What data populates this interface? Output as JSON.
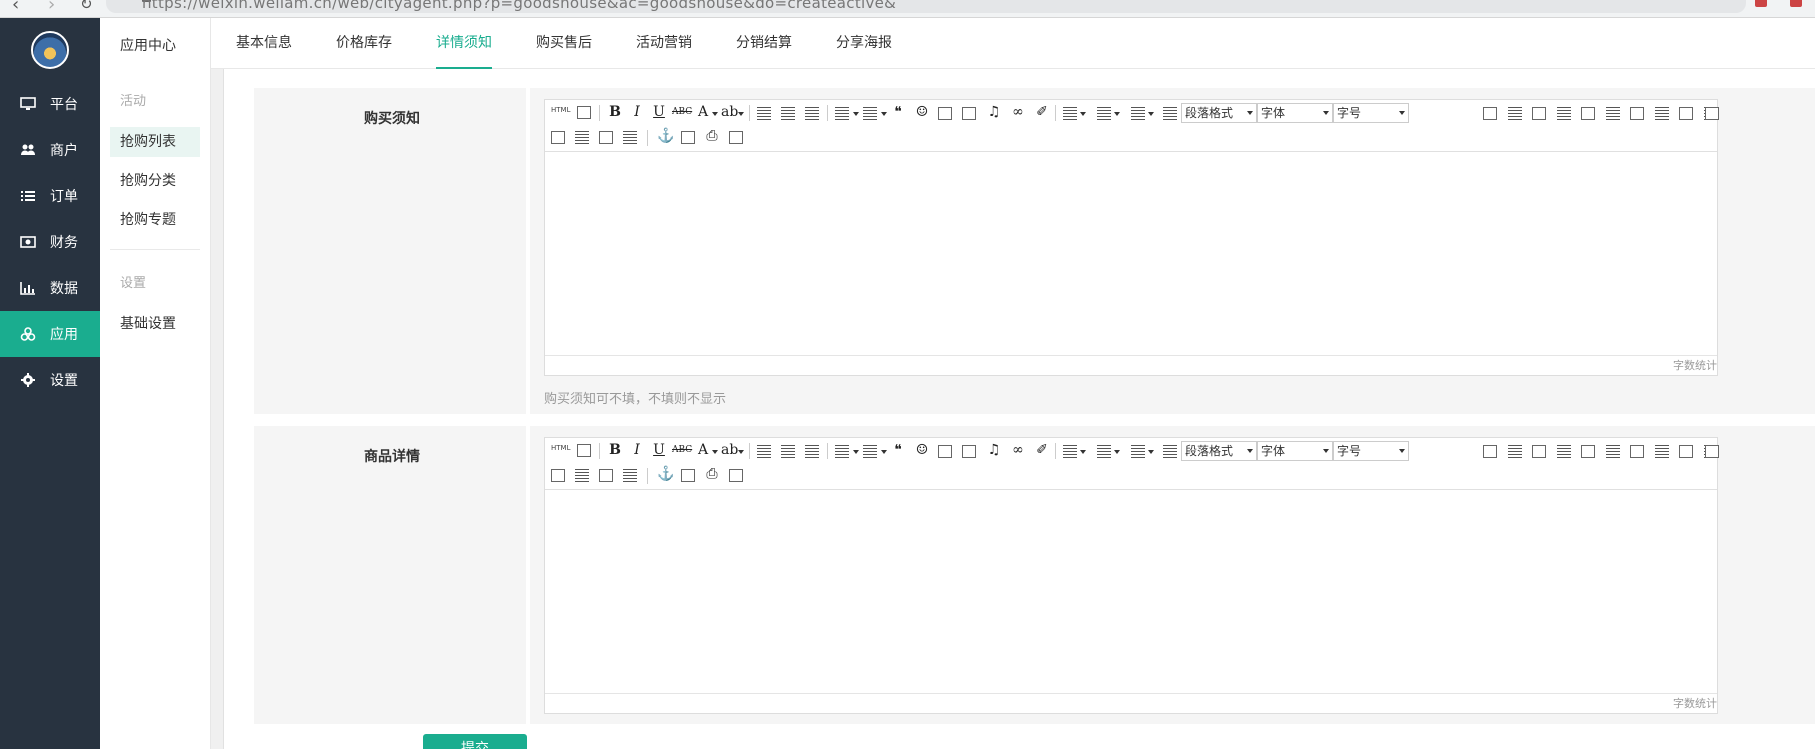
{
  "browser": {
    "url": "https://weixin.weliam.cn/web/cityagent.php?p=goodshouse&ac=goodshouse&do=createactive&"
  },
  "sidebar": {
    "items": [
      {
        "label": "平台",
        "icon": "monitor-icon"
      },
      {
        "label": "商户",
        "icon": "users-icon"
      },
      {
        "label": "订单",
        "icon": "list-icon"
      },
      {
        "label": "财务",
        "icon": "money-icon"
      },
      {
        "label": "数据",
        "icon": "bar-chart-icon"
      },
      {
        "label": "应用",
        "icon": "cubes-icon",
        "active": true
      },
      {
        "label": "设置",
        "icon": "gear-icon"
      }
    ]
  },
  "subsidebar": {
    "title": "应用中心",
    "section1": "活动",
    "items1": [
      "抢购列表",
      "抢购分类",
      "抢购专题"
    ],
    "section2": "设置",
    "items2": [
      "基础设置"
    ]
  },
  "tabs": [
    "基本信息",
    "价格库存",
    "详情须知",
    "购买售后",
    "活动营销",
    "分销结算",
    "分享海报"
  ],
  "active_tab": "详情须知",
  "form": {
    "notice": {
      "label": "购买须知",
      "hint": "购买须知可不填，不填则不显示",
      "wordcount": "字数统计"
    },
    "detail": {
      "label": "商品详情",
      "wordcount": "字数统计"
    },
    "submit_label": "提交"
  },
  "editor_toolbar": {
    "html_label": "HTML",
    "paragraph_format": "段落格式",
    "font_family": "字体",
    "font_size": "字号"
  },
  "colors": {
    "accent": "#1aad8f",
    "sidebar_bg": "#283340"
  }
}
